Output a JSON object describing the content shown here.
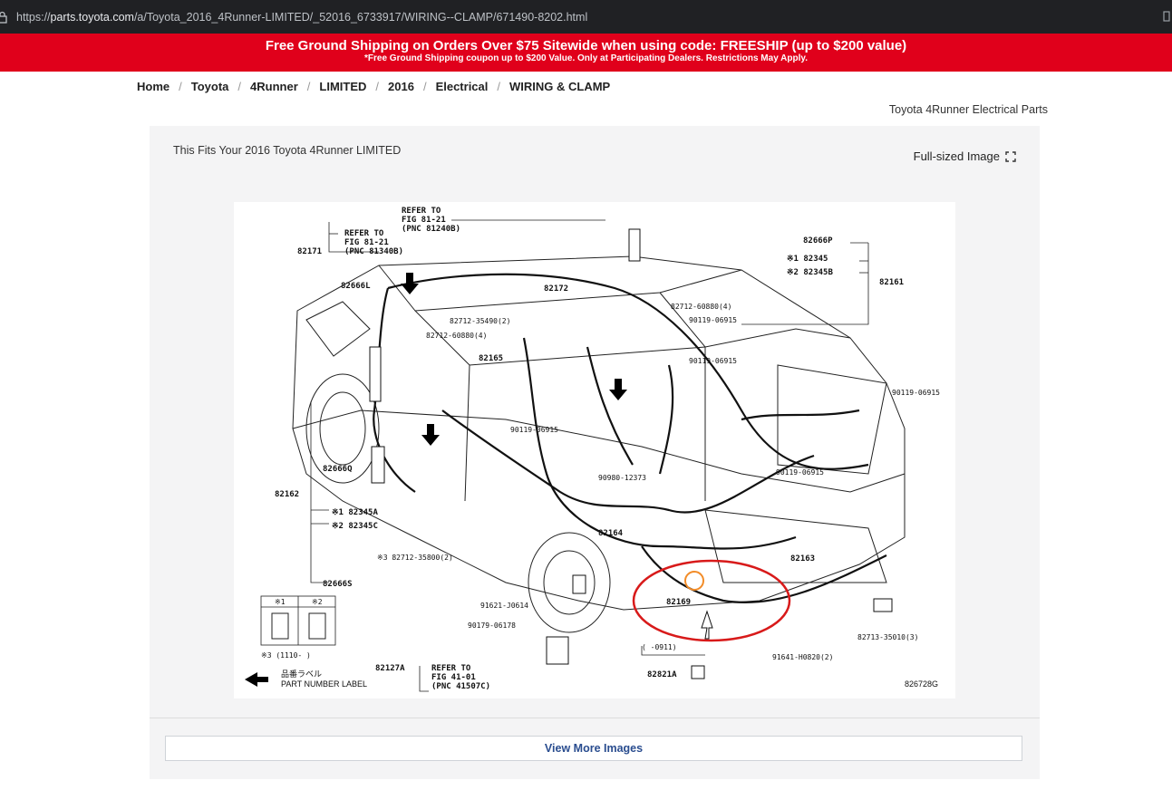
{
  "browser": {
    "url_prefix": "https://",
    "url_host": "parts.toyota.com",
    "url_path": "/a/Toyota_2016_4Runner-LIMITED/_52016_6733917/WIRING--CLAMP/671490-8202.html"
  },
  "promo": {
    "line1": "Free Ground Shipping on Orders Over $75 Sitewide when using code: FREESHIP (up to $200 value)",
    "line2": "*Free Ground Shipping coupon up to $200 Value. Only at Participating Dealers. Restrictions May Apply.",
    "color": "#e0001b"
  },
  "breadcrumb": [
    "Home",
    "Toyota",
    "4Runner",
    "LIMITED",
    "2016",
    "Electrical",
    "WIRING & CLAMP"
  ],
  "category_link": "Toyota 4Runner Electrical Parts",
  "panel": {
    "fits_text": "This Fits Your 2016 Toyota 4Runner LIMITED",
    "full_size_label": "Full-sized Image",
    "full_size_icon": "expand-icon",
    "view_more_label": "View More Images"
  },
  "diagram": {
    "refer_top": [
      "REFER TO",
      "FIG 81-21",
      "(PNC 81240B)"
    ],
    "refer_left": [
      "REFER TO",
      "FIG 81-21",
      "(PNC 81340B)"
    ],
    "refer_bottom": [
      "REFER TO",
      "FIG 41-01",
      "(PNC 41507C)"
    ],
    "part_labels": [
      "82171",
      "82666L",
      "82172",
      "82712-35490(2)",
      "82712-60880(4)",
      "82165",
      "82666P",
      "※1 82345",
      "※2 82345B",
      "82161",
      "82712-60880(4)",
      "90119-06915",
      "90119-06915",
      "90119-06915",
      "90119-06915",
      "90119-06915",
      "90980-12373",
      "82666Q",
      "82162",
      "※1 82345A",
      "※2 82345C",
      "82164",
      "82163",
      "※3 82712-35800(2)",
      "82666S",
      "82169",
      "91621-J0614",
      "90179-06178",
      "82713-35010(3)",
      "91641-H0820(2)",
      "82127A",
      "(     -0911)",
      "82821A"
    ],
    "legend_headers": [
      "※1",
      "※2"
    ],
    "legend_note": "※3 (1110-      )",
    "part_label_jp": "品番ラベル",
    "part_label_en": "PART NUMBER LABEL",
    "figure_code": "826728G",
    "highlight_ellipse_color": "#d81a1a",
    "highlight_circle_color": "#f28c28"
  }
}
